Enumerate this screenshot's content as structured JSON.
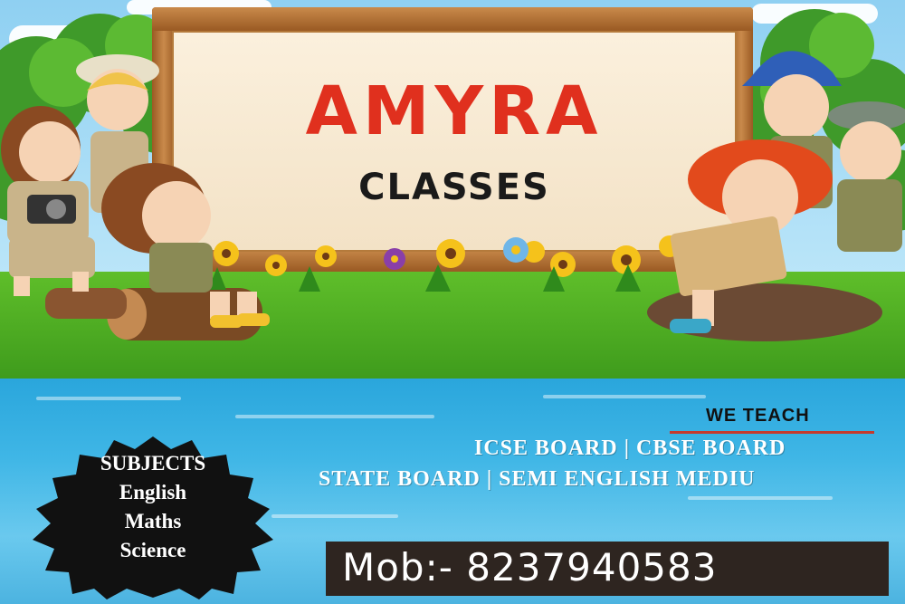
{
  "poster": {
    "title": "AMYRA",
    "subtitle": "CLASSES"
  },
  "we_teach": {
    "heading": "WE TEACH",
    "line1": "ICSE BOARD | CBSE BOARD",
    "line2": "STATE BOARD | SEMI ENGLISH MEDIU"
  },
  "subjects": {
    "heading": "SUBJECTS",
    "items": [
      "English",
      "Maths",
      "Science"
    ]
  },
  "contact": {
    "mobile": "Mob:- 8237940583"
  },
  "colors": {
    "title_red": "#e0301e",
    "board_wood": "#b47a3b",
    "badge_black": "#111111",
    "mobile_box": "#2e2520",
    "water_blue": "#2aa6dc",
    "grass_green": "#4fb025"
  }
}
